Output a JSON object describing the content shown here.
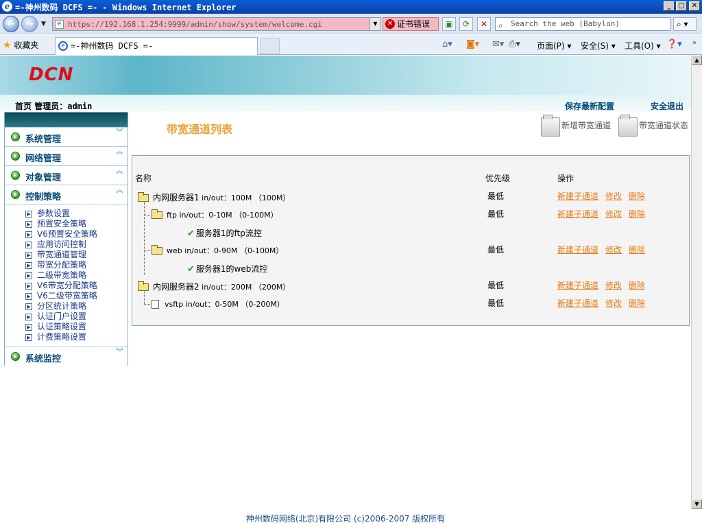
{
  "window": {
    "title": "=-神州数码 DCFS =- - Windows Internet Explorer",
    "min": "_",
    "max": "□",
    "close": "✕"
  },
  "address_bar": {
    "url": "https://192.168.1.254:9999/admin/show/system/welcome.cgi",
    "cert_error": "证书错误",
    "search_placeholder": "Search the web (Babylon)"
  },
  "tabs_bar": {
    "favorites": "收藏夹",
    "tab_title": "=-神州数码 DCFS =-",
    "page_menu": "页面(P)",
    "safety_menu": "安全(S)",
    "tools_menu": "工具(O)"
  },
  "banner": {
    "logo": "DCN"
  },
  "header": {
    "home": "首页",
    "admin_label": "管理员：",
    "admin_name": "admin",
    "save_config": "保存最新配置",
    "logout": "安全退出"
  },
  "sidebar": {
    "groups": [
      {
        "label": "系统管理",
        "chev": "︾"
      },
      {
        "label": "网络管理",
        "chev": "︽"
      },
      {
        "label": "对象管理",
        "chev": "︽"
      },
      {
        "label": "控制策略",
        "chev": "︽"
      },
      {
        "label": "系统监控",
        "chev": "︾"
      }
    ],
    "sub_items": [
      "参数设置",
      "预置安全策略",
      "V6预置安全策略",
      "应用访问控制",
      "带宽通道管理",
      "带宽分配策略",
      "二级带宽策略",
      "V6带宽分配策略",
      "V6二级带宽策略",
      "分区统计策略",
      "认证门户设置",
      "认证策略设置",
      "计费策略设置"
    ]
  },
  "main": {
    "title": "带宽通道列表",
    "add_channel": "新增带宽通道",
    "channel_status": "带宽通道状态",
    "columns": {
      "name": "名称",
      "priority": "优先级",
      "ops": "操作"
    },
    "rows": [
      {
        "name_cn": "内网服务器1",
        "name_rest": " in/out：100M （100M）",
        "priority": "最低",
        "op_add": "新建子通道",
        "op_edit": "修改",
        "op_del": "删除"
      },
      {
        "name_cn": "",
        "name_rest": "ftp in/out：0-10M （0-100M）",
        "priority": "最低",
        "op_add": "新建子通道",
        "op_edit": "修改",
        "op_del": "删除"
      },
      {
        "name_cn": "服务器1的ftp流控",
        "name_rest": ""
      },
      {
        "name_cn": "",
        "name_rest": "web in/out：0-90M （0-100M）",
        "priority": "最低",
        "op_add": "新建子通道",
        "op_edit": "修改",
        "op_del": "删除"
      },
      {
        "name_cn": "服务器1的web流控",
        "name_rest": ""
      },
      {
        "name_cn": "内网服务器2",
        "name_rest": " in/out：200M （200M）",
        "priority": "最低",
        "op_add": "新建子通道",
        "op_edit": "修改",
        "op_del": "删除"
      },
      {
        "name_cn": "",
        "name_rest": "vsftp in/out：0-50M （0-200M）",
        "priority": "最低",
        "op_add": "新建子通道",
        "op_edit": "修改",
        "op_del": "删除"
      }
    ]
  },
  "footer": {
    "copyright": "神州数码网络(北京)有限公司 (c)2006-2007 版权所有"
  },
  "colors": {
    "title_orange": "#e8a33a",
    "link_orange": "#e87a10",
    "menu_blue": "#0a4a7a",
    "logo_red": "#e10d16"
  }
}
